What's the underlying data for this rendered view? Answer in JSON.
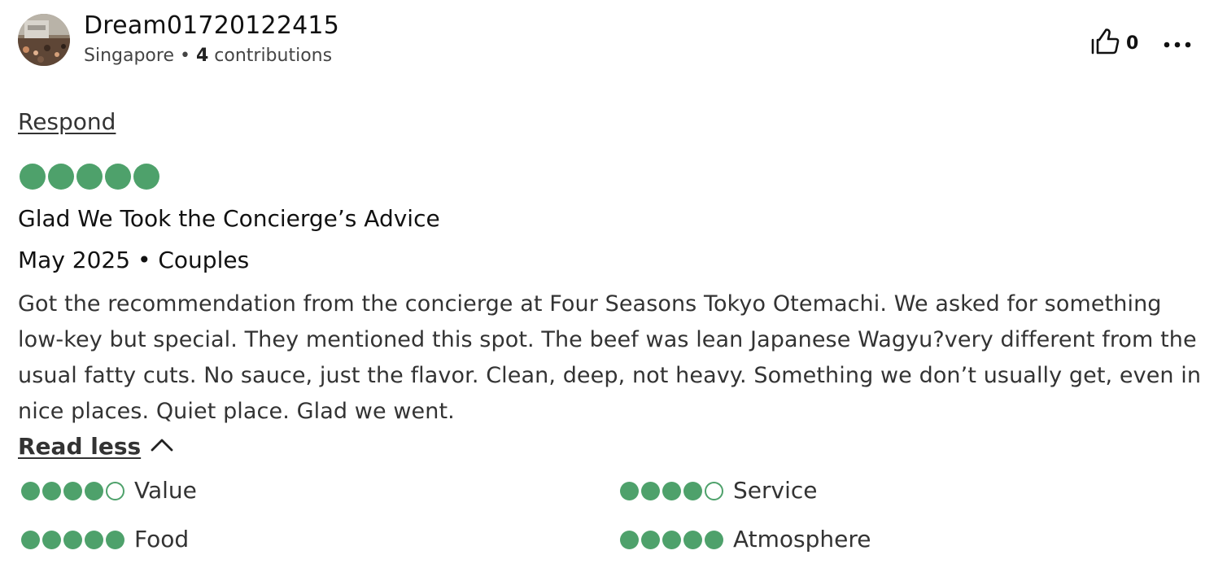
{
  "reviewer": {
    "username": "Dream01720122415",
    "location": "Singapore",
    "separator": " • ",
    "contributions_count": "4",
    "contributions_label": " contributions"
  },
  "actions": {
    "helpful_count": "0",
    "respond_label": "Respond",
    "read_less_label": "Read less"
  },
  "review": {
    "overall_rating": 5,
    "title": "Glad We Took the Concierge’s Advice",
    "date_and_type": "May 2025 • Couples",
    "body": "Got the recommendation from the concierge at Four Seasons Tokyo Otemachi. We asked for something low-key but special. They mentioned this spot. The beef was lean Japanese Wagyu?very different from the usual fatty cuts. No sauce, just the flavor. Clean, deep, not heavy. Something we don’t usually get, even in nice places. Quiet place. Glad we went."
  },
  "subratings": [
    {
      "label": "Value",
      "rating": 4
    },
    {
      "label": "Service",
      "rating": 4
    },
    {
      "label": "Food",
      "rating": 5
    },
    {
      "label": "Atmosphere",
      "rating": 5
    }
  ],
  "icons": {
    "avatar": "avatar-photo",
    "helpful": "thumbs-up-icon",
    "more": "more-options-icon",
    "collapse": "chevron-up-icon"
  },
  "colors": {
    "bubble_green": "#4ea16b",
    "text_primary": "#111111",
    "text_secondary": "#444444"
  }
}
